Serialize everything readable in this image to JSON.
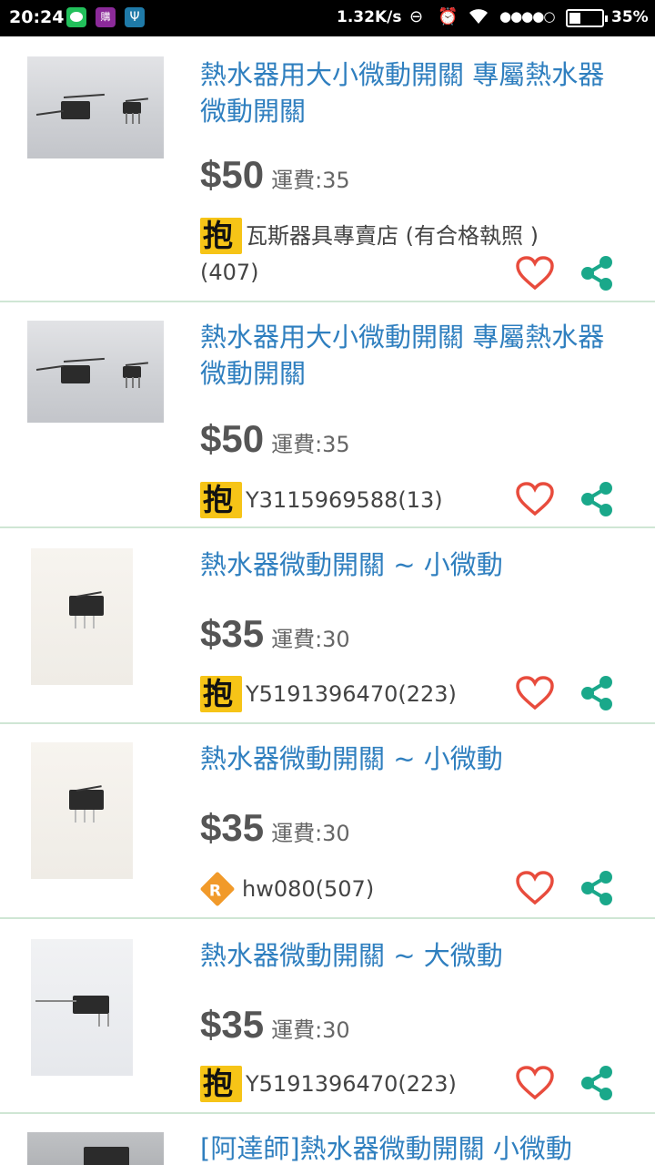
{
  "status_bar": {
    "time": "20:24",
    "app_icon_2": "購",
    "app_icon_3": "Ψ",
    "net_speed": "1.32K/s",
    "signal": "●●●●○",
    "battery_text": "35%",
    "battery_level": 0.35
  },
  "colors": {
    "title": "#2f7fbf",
    "heart": "#e84c3d",
    "share": "#1aa88a",
    "badge": "#f6c417"
  },
  "items": [
    {
      "title": "熱水器用大小微動開關 專屬熱水器微動開關",
      "price": "$50",
      "shipping": "運費:35",
      "seller": "瓦斯器具專賣店 (有合格執照 )",
      "seller_count": "(407)",
      "badge": "yellow"
    },
    {
      "title": "熱水器用大小微動開關 專屬熱水器微動開關",
      "price": "$50",
      "shipping": "運費:35",
      "seller": "Y3115969588(13)",
      "seller_count": "",
      "badge": "yellow"
    },
    {
      "title": "熱水器微動開關 ~ 小微動",
      "price": "$35",
      "shipping": "運費:30",
      "seller": "Y5191396470(223)",
      "seller_count": "",
      "badge": "yellow"
    },
    {
      "title": "熱水器微動開關 ~ 小微動",
      "price": "$35",
      "shipping": "運費:30",
      "seller": "hw080(507)",
      "seller_count": "",
      "badge": "orange"
    },
    {
      "title": "熱水器微動開關 ~ 大微動",
      "price": "$35",
      "shipping": "運費:30",
      "seller": "Y5191396470(223)",
      "seller_count": "",
      "badge": "yellow"
    },
    {
      "title": "[阿達師]熱水器微動開關 小微動",
      "price": "",
      "shipping": "",
      "seller": "",
      "seller_count": "",
      "badge": ""
    }
  ]
}
